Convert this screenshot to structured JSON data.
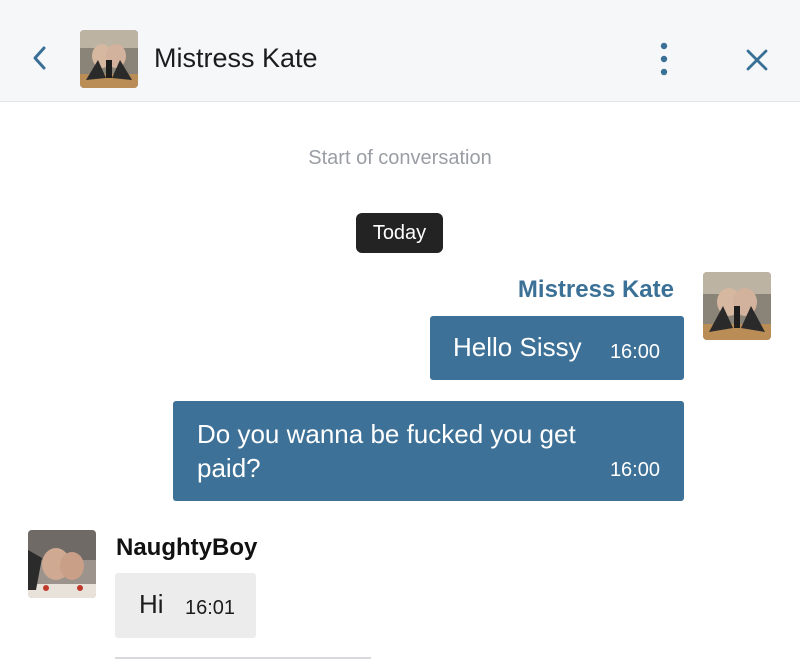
{
  "header": {
    "title": "Mistress Kate",
    "back_icon": "chevron-left-icon",
    "more_icon": "more-vertical-icon",
    "close_icon": "close-icon"
  },
  "conversation": {
    "start_text": "Start of conversation",
    "date_label": "Today"
  },
  "messages": [
    {
      "sender": "Mistress Kate",
      "items": [
        {
          "text": "Hello Sissy",
          "time": "16:00"
        },
        {
          "text": "Do you wanna be fucked you get paid?",
          "time": "16:00"
        }
      ]
    },
    {
      "sender": "NaughtyBoy",
      "items": [
        {
          "text": "Hi",
          "time": "16:01"
        }
      ]
    }
  ],
  "colors": {
    "accent": "#3d7197",
    "sender_name": "#3b7196",
    "date_pill": "#232323",
    "incoming_bubble": "#ececec"
  }
}
